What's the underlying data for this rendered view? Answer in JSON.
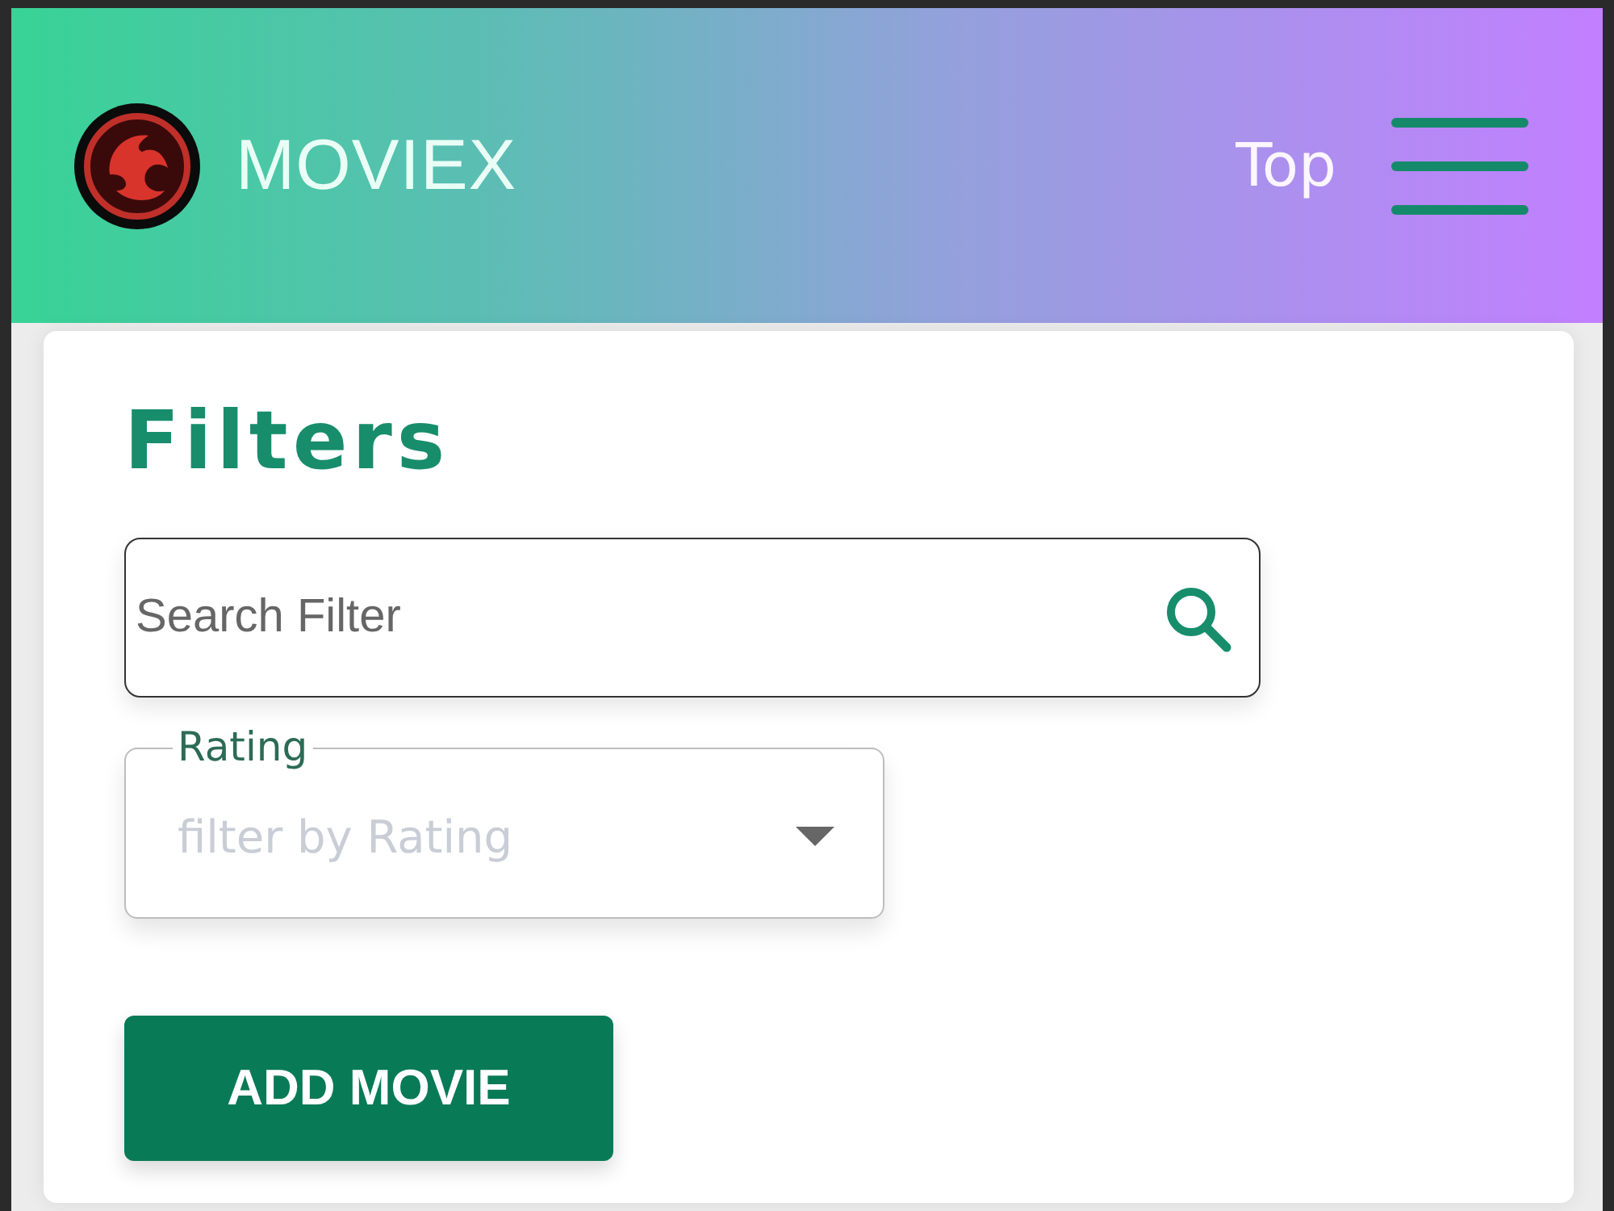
{
  "header": {
    "brand": "MOVIEX",
    "nav_link": "Top"
  },
  "filters": {
    "title": "Filters",
    "search": {
      "placeholder": "Search Filter"
    },
    "rating_select": {
      "label": "Rating",
      "placeholder": "filter by Rating"
    }
  },
  "add_button": "ADD MOVIE"
}
